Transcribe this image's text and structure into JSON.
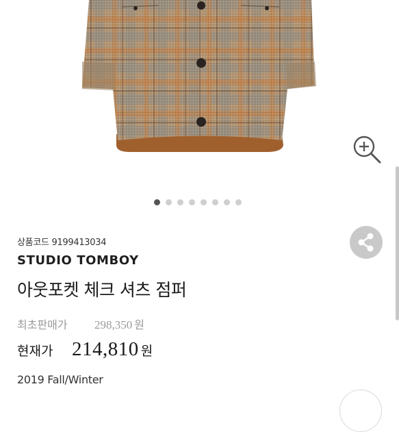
{
  "product": {
    "code_label": "상품코드",
    "code": "9199413034",
    "brand": "STUDIO TOMBOY",
    "title": "아웃포켓 체크 셔츠 점퍼",
    "season": "2019 Fall/Winter"
  },
  "price": {
    "original_label": "최초판매가",
    "original_value": "298,350",
    "original_unit": "원",
    "current_label": "현재가",
    "current_value": "214,810",
    "current_unit": "원"
  },
  "gallery": {
    "total_images": 8,
    "active_index": 0
  },
  "icons": {
    "zoom": "zoom-in-icon",
    "share": "share-icon"
  },
  "colors": {
    "plaid_brown": "#a57a52",
    "lining": "#a0602e",
    "dot_active": "#555555",
    "dot_inactive": "#cfcfcf",
    "share_bg": "#c9c9c9"
  }
}
